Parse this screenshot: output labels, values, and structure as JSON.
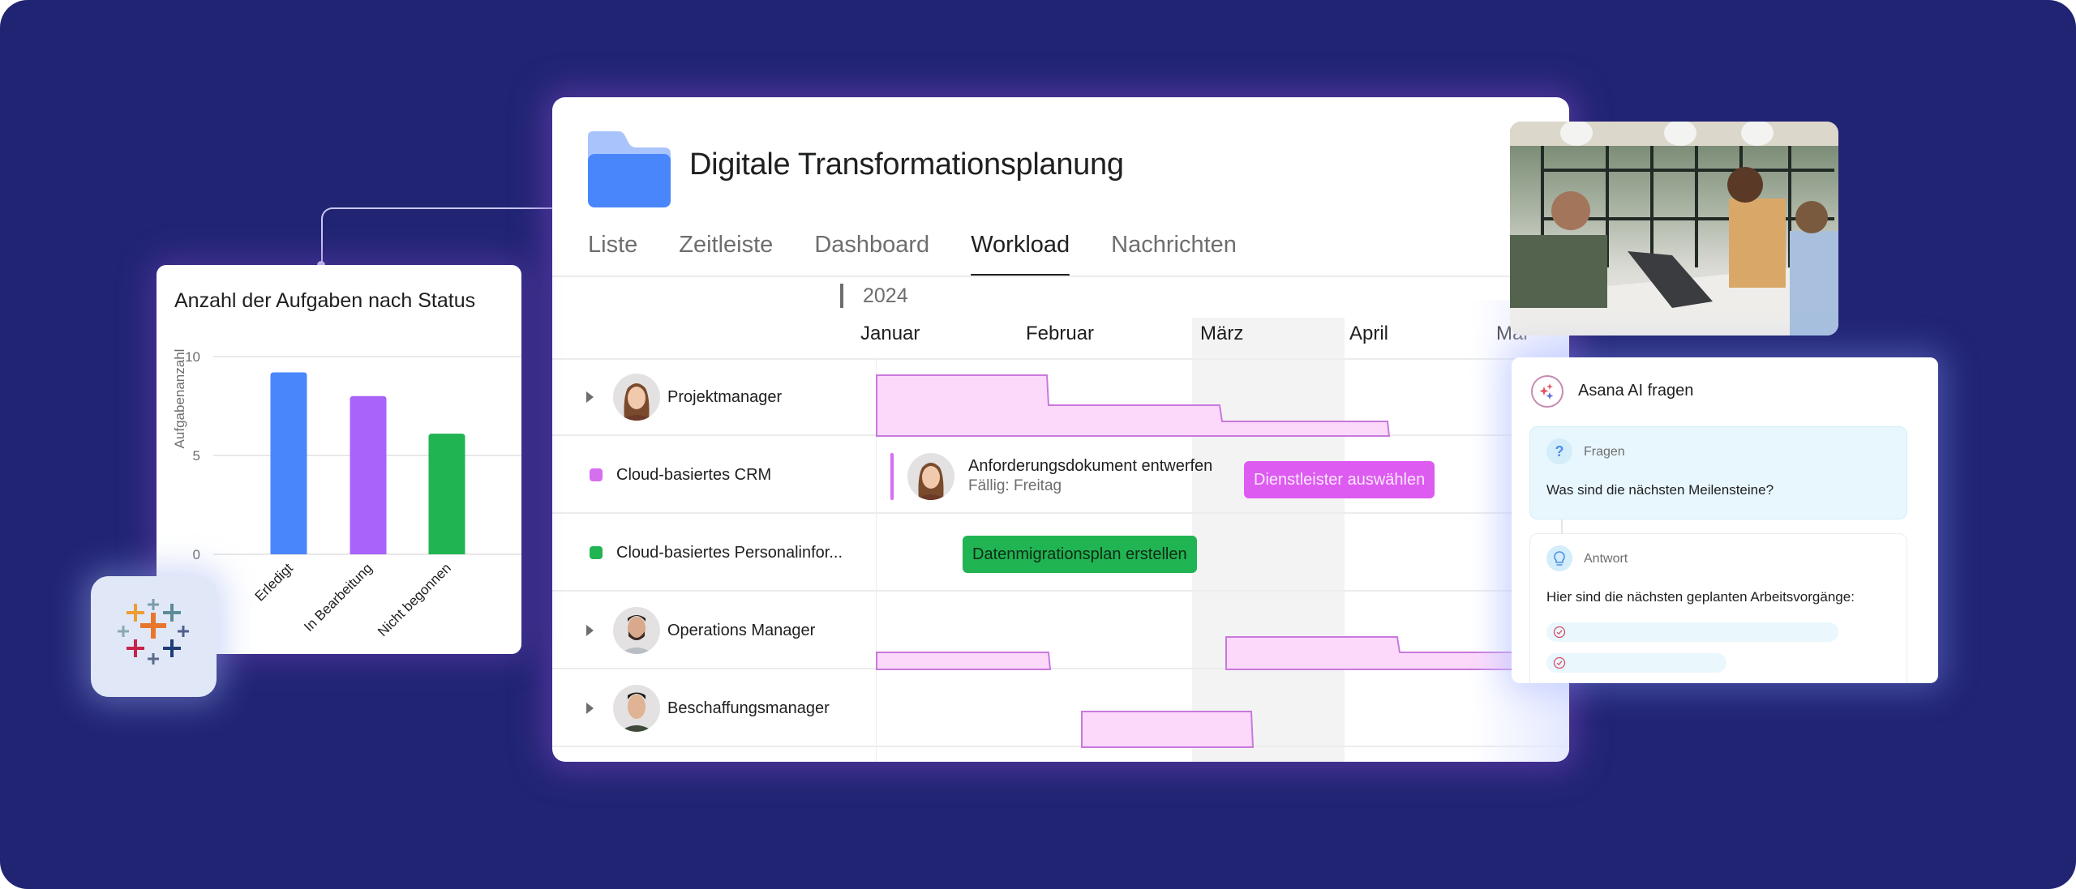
{
  "project": {
    "title": "Digitale Transformationsplanung",
    "icon": "folder-icon",
    "tabs": [
      {
        "label": "Liste",
        "active": false
      },
      {
        "label": "Zeitleiste",
        "active": false
      },
      {
        "label": "Dashboard",
        "active": false
      },
      {
        "label": "Workload",
        "active": true
      },
      {
        "label": "Nachrichten",
        "active": false
      }
    ]
  },
  "timeline": {
    "year": "2024",
    "months": [
      "Januar",
      "Februar",
      "März",
      "April",
      "Mai"
    ],
    "highlighted_month": "März"
  },
  "workload": {
    "rows": [
      {
        "type": "person",
        "name": "Projektmanager",
        "avatar": "avatar-woman"
      },
      {
        "type": "project",
        "name": "Cloud-basiertes CRM",
        "color": "#d56ff0"
      },
      {
        "type": "project",
        "name": "Cloud-basiertes Personalinfor...",
        "color": "#21b452"
      },
      {
        "type": "person",
        "name": "Operations Manager",
        "avatar": "avatar-man-beard"
      },
      {
        "type": "person",
        "name": "Beschaffungsmanager",
        "avatar": "avatar-man-smiling"
      }
    ],
    "tasks": {
      "crm_task": {
        "title": "Anforderungsdokument entwerfen",
        "due": "Fällig: Freitag"
      },
      "crm_pill": {
        "label": "Dienstleister auswählen",
        "color": "#dd5bf0"
      },
      "hr_pill": {
        "label": "Datenmigrationsplan erstellen",
        "color": "#21b452"
      }
    },
    "colors": {
      "load_fill": "#fcd9fb",
      "load_stroke": "#c879dd"
    }
  },
  "chart_card": {
    "title": "Anzahl der Aufgaben nach Status"
  },
  "chart_data": {
    "type": "bar",
    "title": "Anzahl der Aufgaben nach Status",
    "categories": [
      "Erledigt",
      "In Bearbeitung",
      "Nicht begonnen"
    ],
    "values": [
      9.2,
      8,
      6.1
    ],
    "colors": [
      "#4a86fb",
      "#a863fb",
      "#21b452"
    ],
    "xlabel": "",
    "ylabel": "Aufgabenanzahl",
    "ylim": [
      0,
      10
    ],
    "yticks": [
      "0",
      "5",
      "10"
    ],
    "grid": true
  },
  "integration": {
    "name": "tableau-logo"
  },
  "ai_panel": {
    "title": "Asana AI fragen",
    "question": {
      "label": "Fragen",
      "text": "Was sind die nächsten Meilensteine?"
    },
    "answer": {
      "label": "Antwort",
      "text": "Hier sind die nächsten geplanten Arbeitsvorgänge:"
    }
  },
  "background_color": "#212473"
}
